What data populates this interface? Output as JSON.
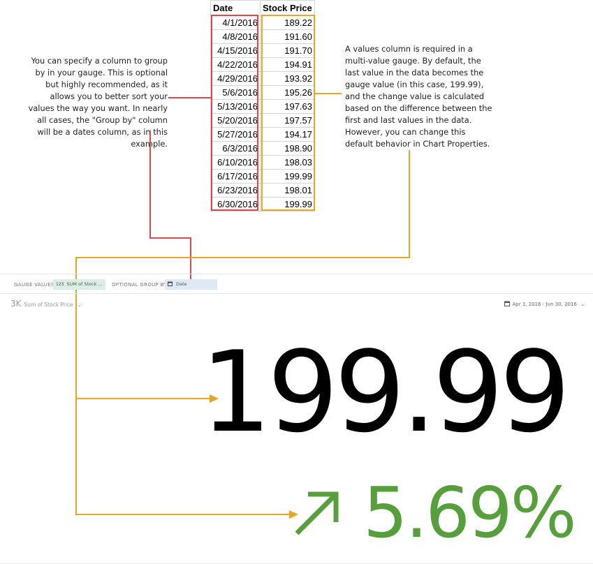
{
  "table": {
    "headers": [
      "Date",
      "Stock Price"
    ],
    "rows": [
      [
        "4/1/2016",
        "189.22"
      ],
      [
        "4/8/2016",
        "191.60"
      ],
      [
        "4/15/2016",
        "191.70"
      ],
      [
        "4/22/2016",
        "194.91"
      ],
      [
        "4/29/2016",
        "193.92"
      ],
      [
        "5/6/2016",
        "195.26"
      ],
      [
        "5/13/2016",
        "197.63"
      ],
      [
        "5/20/2016",
        "197.57"
      ],
      [
        "5/27/2016",
        "194.17"
      ],
      [
        "6/3/2016",
        "198.90"
      ],
      [
        "6/10/2016",
        "198.03"
      ],
      [
        "6/17/2016",
        "199.99"
      ],
      [
        "6/23/2016",
        "198.01"
      ],
      [
        "6/30/2016",
        "199.99"
      ]
    ]
  },
  "annotations": {
    "group_by_note": "You can specify a column to group by in your gauge. This is optional but highly recommended, as it allows you to better sort your values the way you want. In nearly all cases, the \"Group by\" column will be a dates column, as in this example.",
    "values_note": "A values column is required in a multi-value gauge. By default, the last value in the data becomes the gauge value (in this case, 199.99), and the change value is calculated based on the difference between the first and last values in the data. However, you can change this default behavior in Chart Properties."
  },
  "toolbar": {
    "gauge_values_label": "GAUGE VALUES",
    "gauge_values_chip": "SUM of Stock ...",
    "gauge_values_icon": "123",
    "group_by_label": "OPTIONAL GROUP BY",
    "group_by_chip": "Date",
    "group_by_icon": "calendar-icon"
  },
  "gauge": {
    "title_value": "3K",
    "title_label": "Sum of Stock Price",
    "date_range": "Apr 1, 2016 - Jun 30, 2016",
    "value": "199.99",
    "change": "5.69%",
    "change_direction": "up",
    "change_color": "#55a03a"
  },
  "colors": {
    "group_by_highlight": "#e0474c",
    "values_highlight": "#eaa423"
  }
}
